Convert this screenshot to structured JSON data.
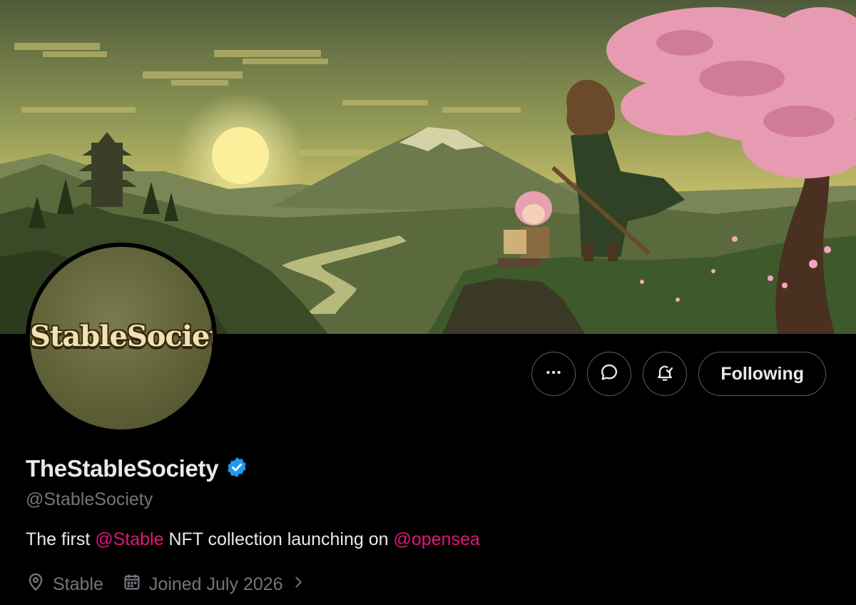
{
  "profile": {
    "display_name": "TheStableSociety",
    "handle": "@StableSociety",
    "avatar_text": "StableSociety",
    "verified_icon": "verified-badge-icon",
    "bio": {
      "prefix": "The first ",
      "mention1": "@Stable",
      "middle": " NFT collection launching on ",
      "mention2": "@opensea"
    },
    "location": "Stable",
    "joined": "Joined July 2026"
  },
  "actions": {
    "more_icon": "more-horizontal-icon",
    "message_icon": "message-bubble-icon",
    "notify_icon": "bell-icon",
    "follow_label": "Following"
  },
  "colors": {
    "background": "#000000",
    "text": "#e7e9ea",
    "secondary_text": "#71767b",
    "mention": "#e6147c",
    "verified": "#1d9bf0",
    "button_border": "#536471"
  }
}
